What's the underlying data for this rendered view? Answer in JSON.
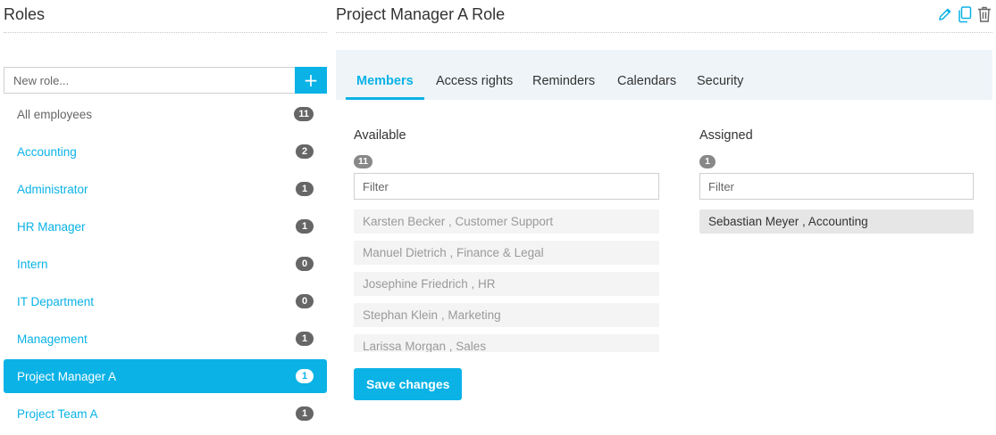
{
  "roles": {
    "title": "Roles",
    "new_role_placeholder": "New role...",
    "add_label": "+",
    "items": [
      {
        "label": "All employees",
        "count": "11"
      },
      {
        "label": "Accounting",
        "count": "2"
      },
      {
        "label": "Administrator",
        "count": "1"
      },
      {
        "label": "HR Manager",
        "count": "1"
      },
      {
        "label": "Intern",
        "count": "0"
      },
      {
        "label": "IT Department",
        "count": "0"
      },
      {
        "label": "Management",
        "count": "1"
      },
      {
        "label": "Project Manager A",
        "count": "1"
      },
      {
        "label": "Project Team A",
        "count": "1"
      }
    ],
    "selected_index": 7
  },
  "detail": {
    "title": "Project Manager A Role",
    "icons": [
      "pencil-icon",
      "copy-icon",
      "trash-icon"
    ],
    "tabs": [
      "Members",
      "Access rights",
      "Reminders",
      "Calendars",
      "Security"
    ],
    "active_tab": "Members",
    "available": {
      "title": "Available",
      "count": "11",
      "filter_placeholder": "Filter",
      "members": [
        "Karsten Becker , Customer Support",
        "Manuel Dietrich , Finance & Legal",
        "Josephine Friedrich , HR",
        "Stephan Klein , Marketing",
        "Larissa Morgan , Sales"
      ]
    },
    "assigned": {
      "title": "Assigned",
      "count": "1",
      "filter_placeholder": "Filter",
      "members": [
        "Sebastian Meyer , Accounting"
      ]
    },
    "save_label": "Save changes"
  },
  "colors": {
    "accent": "#0ab2e6",
    "badge": "#666666",
    "tab_bg": "#eef4f8"
  }
}
